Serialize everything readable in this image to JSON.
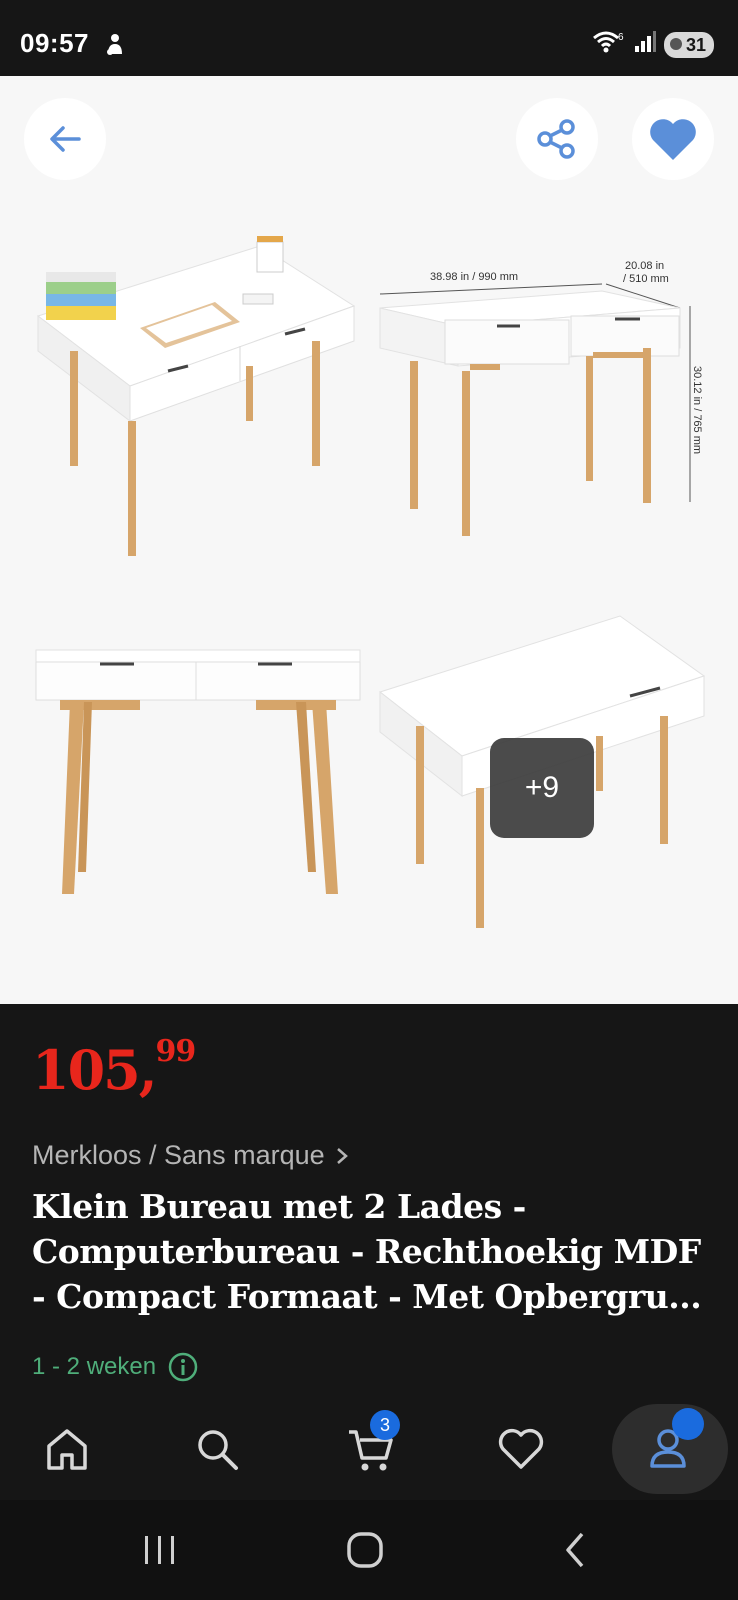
{
  "status": {
    "time": "09:57",
    "battery": "31"
  },
  "gallery": {
    "dimensions": {
      "width": "38.98 in / 990 mm",
      "depth_line1": "20.08 in",
      "depth_line2": "/ 510 mm",
      "height": "30.12 in / 765 mm"
    },
    "more_count": "+9"
  },
  "product": {
    "price_whole": "105,",
    "price_cents": "99",
    "brand": "Merkloos / Sans marque",
    "title": "Klein Bureau met 2 Lades - Computerbureau - Rechthoekig MDF - Compact Formaat - Met Opbergru...",
    "delivery": "1 - 2 weken"
  },
  "nav": {
    "cart_count": "3"
  },
  "colors": {
    "price": "#e8261c",
    "accent": "#1a6bde",
    "icon_blue": "#5b8fd9",
    "delivery_green": "#4fae7a"
  }
}
